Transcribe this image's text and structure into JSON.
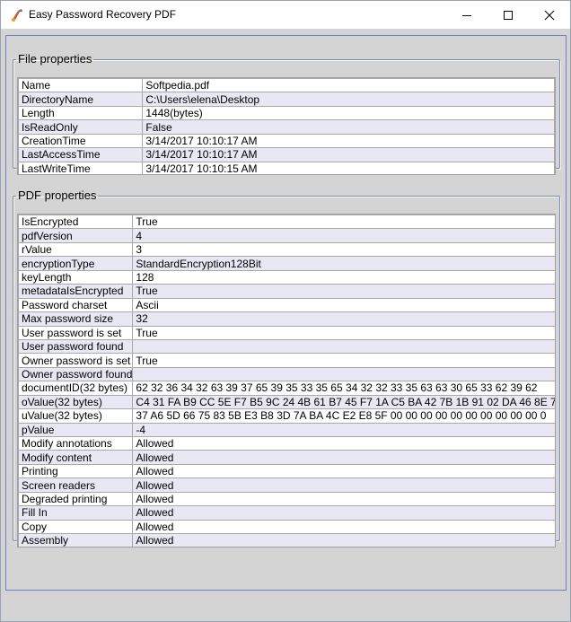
{
  "window": {
    "title": "Easy Password Recovery PDF"
  },
  "file_properties": {
    "legend": "File properties",
    "rows": [
      {
        "key": "Name",
        "value": "Softpedia.pdf"
      },
      {
        "key": "DirectoryName",
        "value": "C:\\Users\\elena\\Desktop"
      },
      {
        "key": "Length",
        "value": "1448(bytes)"
      },
      {
        "key": "IsReadOnly",
        "value": "False"
      },
      {
        "key": "CreationTime",
        "value": "3/14/2017 10:10:17 AM"
      },
      {
        "key": "LastAccessTime",
        "value": "3/14/2017 10:10:17 AM"
      },
      {
        "key": "LastWriteTime",
        "value": "3/14/2017 10:10:15 AM"
      }
    ]
  },
  "pdf_properties": {
    "legend": "PDF properties",
    "rows": [
      {
        "key": "IsEncrypted",
        "value": "True"
      },
      {
        "key": "pdfVersion",
        "value": "4"
      },
      {
        "key": "rValue",
        "value": "3"
      },
      {
        "key": "encryptionType",
        "value": "StandardEncryption128Bit"
      },
      {
        "key": "keyLength",
        "value": "128"
      },
      {
        "key": "metadataIsEncrypted",
        "value": "True"
      },
      {
        "key": "Password charset",
        "value": "Ascii"
      },
      {
        "key": "Max password size",
        "value": "32"
      },
      {
        "key": "User password is set",
        "value": "True"
      },
      {
        "key": "User password found",
        "value": ""
      },
      {
        "key": "Owner password is set",
        "value": "True"
      },
      {
        "key": "Owner password found",
        "value": ""
      },
      {
        "key": "documentID(32 bytes)",
        "value": "62 32 36 34 32 63 39 37 65 39 35 33 35 65 34 32 32 33 35 63 63 30 65 33 62 39 62"
      },
      {
        "key": "oValue(32 bytes)",
        "value": "C4 31 FA B9 CC 5E F7 B5 9C 24 4B 61 B7 45 F7 1A C5 BA 42 7B 1B 91 02 DA 46 8E 7"
      },
      {
        "key": "uValue(32 bytes)",
        "value": "37 A6 5D 66 75 83 5B E3 B8 3D 7A BA 4C E2 E8 5F 00 00 00 00 00 00 00 00 00 00 0"
      },
      {
        "key": "pValue",
        "value": "-4"
      },
      {
        "key": "Modify annotations",
        "value": "Allowed"
      },
      {
        "key": "Modify content",
        "value": "Allowed"
      },
      {
        "key": "Printing",
        "value": "Allowed"
      },
      {
        "key": "Screen readers",
        "value": "Allowed"
      },
      {
        "key": "Degraded printing",
        "value": "Allowed"
      },
      {
        "key": "Fill In",
        "value": "Allowed"
      },
      {
        "key": "Copy",
        "value": "Allowed"
      },
      {
        "key": "Assembly",
        "value": "Allowed"
      }
    ]
  },
  "icons": {
    "app": "pdf-key-icon",
    "minimize": "minimize-icon",
    "maximize": "maximize-icon",
    "close": "close-icon"
  },
  "colors": {
    "alt_row": "#e8e8f5",
    "frame_border": "#6f7fbf",
    "window_bg": "#d4d4d4"
  }
}
